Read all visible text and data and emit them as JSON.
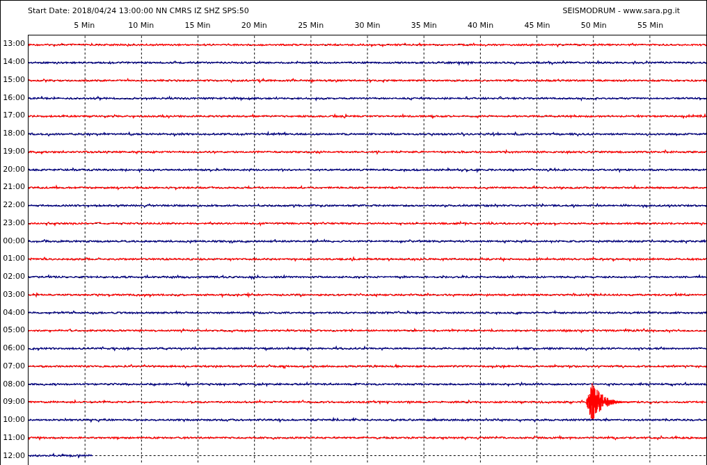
{
  "header": {
    "title": "Start Date: 2018/04/24 13:00:00 NN CMRS IZ SHZ SPS:50",
    "credit": "SEISMODRUM - www.sara.pg.it"
  },
  "time_axis": [
    "5 Min",
    "10 Min",
    "15 Min",
    "20 Min",
    "25 Min",
    "30 Min",
    "35 Min",
    "40 Min",
    "45 Min",
    "50 Min",
    "55 Min"
  ],
  "rows": [
    {
      "label": "13:00",
      "color": "#ff0000",
      "level": 1,
      "event": false
    },
    {
      "label": "14:00",
      "color": "#000080",
      "level": 1,
      "event": false
    },
    {
      "label": "15:00",
      "color": "#ff0000",
      "level": 1,
      "event": false
    },
    {
      "label": "16:00",
      "color": "#000080",
      "level": 1,
      "event": false
    },
    {
      "label": "17:00",
      "color": "#ff0000",
      "level": 1,
      "event": false
    },
    {
      "label": "18:00",
      "color": "#000080",
      "level": 1,
      "event": false
    },
    {
      "label": "19:00",
      "color": "#ff0000",
      "level": 1,
      "event": false
    },
    {
      "label": "20:00",
      "color": "#000080",
      "level": 1,
      "event": false
    },
    {
      "label": "21:00",
      "color": "#ff0000",
      "level": 1,
      "event": false
    },
    {
      "label": "22:00",
      "color": "#000080",
      "level": 1,
      "event": false
    },
    {
      "label": "23:00",
      "color": "#ff0000",
      "level": 1,
      "event": false
    },
    {
      "label": "00:00",
      "color": "#000080",
      "level": 1,
      "event": false
    },
    {
      "label": "01:00",
      "color": "#ff0000",
      "level": 1,
      "event": false
    },
    {
      "label": "02:00",
      "color": "#000080",
      "level": 1,
      "event": false
    },
    {
      "label": "03:00",
      "color": "#ff0000",
      "level": 1,
      "event": false
    },
    {
      "label": "04:00",
      "color": "#000080",
      "level": 1,
      "event": false
    },
    {
      "label": "05:00",
      "color": "#ff0000",
      "level": 1,
      "event": false
    },
    {
      "label": "06:00",
      "color": "#000080",
      "level": 1,
      "event": false
    },
    {
      "label": "07:00",
      "color": "#ff0000",
      "level": 1,
      "event": false
    },
    {
      "label": "08:00",
      "color": "#000080",
      "level": 1,
      "event": false
    },
    {
      "label": "09:00",
      "color": "#ff0000",
      "level": 1,
      "event": true
    },
    {
      "label": "10:00",
      "color": "#000080",
      "level": 1,
      "event": false
    },
    {
      "label": "11:00",
      "color": "#ff0000",
      "level": 1,
      "event": false
    },
    {
      "label": "12:00",
      "color": "#000080",
      "level": 0.095,
      "event": false
    }
  ]
}
